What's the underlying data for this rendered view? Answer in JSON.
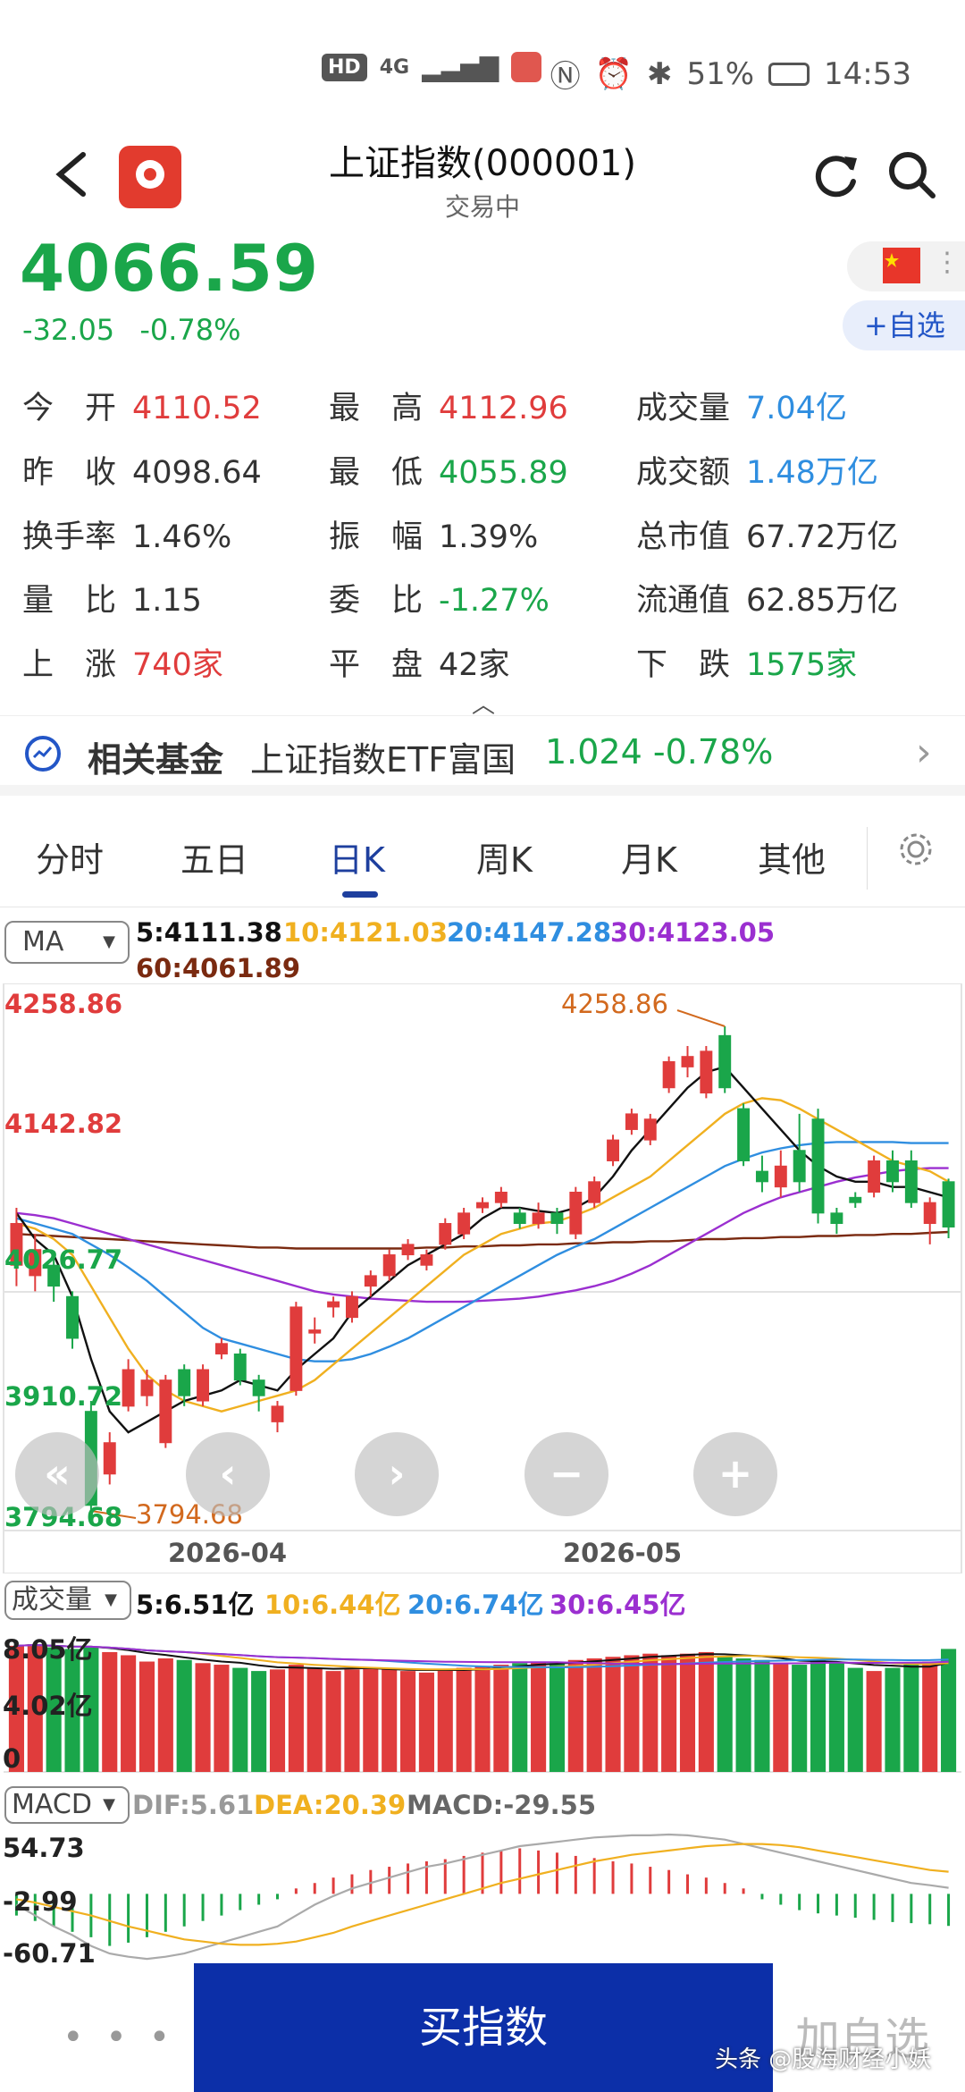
{
  "status_bar": {
    "network": "4G",
    "battery": "51%",
    "time": "14:53"
  },
  "header": {
    "title": "上证指数(000001)",
    "subtitle": "交易中"
  },
  "quote": {
    "price": "4066.59",
    "change": "-32.05",
    "change_pct": "-0.78%",
    "watch_label": "+自选"
  },
  "stats": [
    {
      "label": "今　开",
      "value": "4110.52",
      "color": "red"
    },
    {
      "label": "最　高",
      "value": "4112.96",
      "color": "red"
    },
    {
      "label": "成交量",
      "value": "7.04亿",
      "color": "blue"
    },
    {
      "label": "昨　收",
      "value": "4098.64",
      "color": "dark"
    },
    {
      "label": "最　低",
      "value": "4055.89",
      "color": "green"
    },
    {
      "label": "成交额",
      "value": "1.48万亿",
      "color": "blue"
    },
    {
      "label": "换手率",
      "value": "1.46%",
      "color": "dark"
    },
    {
      "label": "振　幅",
      "value": "1.39%",
      "color": "dark"
    },
    {
      "label": "总市值",
      "value": "67.72万亿",
      "color": "dark"
    },
    {
      "label": "量　比",
      "value": "1.15",
      "color": "dark"
    },
    {
      "label": "委　比",
      "value": "-1.27%",
      "color": "green"
    },
    {
      "label": "流通值",
      "value": "62.85万亿",
      "color": "dark"
    },
    {
      "label": "上　涨",
      "value": "740家",
      "color": "red"
    },
    {
      "label": "平　盘",
      "value": "42家",
      "color": "dark"
    },
    {
      "label": "下　跌",
      "value": "1575家",
      "color": "green"
    }
  ],
  "fund": {
    "label": "相关基金",
    "name": "上证指数ETF富国",
    "price": "1.024",
    "change_pct": "-0.78%"
  },
  "tabs": [
    "分时",
    "五日",
    "日K",
    "周K",
    "月K",
    "其他"
  ],
  "ma": {
    "selector": "MA",
    "ma5": "5:4111.38",
    "ma10": "10:4121.03",
    "ma20": "20:4147.28",
    "ma30": "30:4123.05",
    "ma60": "60:4061.89"
  },
  "kchart": {
    "y_labels": [
      "4258.86",
      "4142.82",
      "4026.77",
      "3910.72",
      "3794.68"
    ],
    "high_marker": "4258.86",
    "low_marker": "3794.68",
    "x_labels": [
      "2026-04",
      "2026-05"
    ]
  },
  "volume": {
    "selector": "成交量",
    "ma5": "5:6.51亿",
    "ma10": "10:6.44亿",
    "ma20": "20:6.74亿",
    "ma30": "30:6.45亿",
    "y_labels": [
      "8.05亿",
      "4.02亿",
      "0"
    ]
  },
  "macd": {
    "selector": "MACD",
    "dif": "DIF:5.61",
    "dea": "DEA:20.39",
    "macd": "MACD:-29.55",
    "y_labels": [
      "54.73",
      "-2.99",
      "-60.71"
    ]
  },
  "bottom": {
    "more": "• • •",
    "buy": "买指数",
    "add_watch": "加自选",
    "watermark": "头条 @股海财经小妖"
  },
  "colors": {
    "up": "#e03c3c",
    "down": "#1aa64a",
    "ma5": "#111111",
    "ma10": "#f0b020",
    "ma20": "#2f8ee0",
    "ma30": "#9b2fd0",
    "ma60": "#7a2a10",
    "accent": "#0c2fa8"
  },
  "chart_data": {
    "type": "candlestick",
    "ylim": [
      3794.68,
      4258.86
    ],
    "candles": [
      {
        "o": 4030,
        "c": 4070,
        "h": 4085,
        "l": 4010
      },
      {
        "o": 4020,
        "c": 4045,
        "h": 4060,
        "l": 4005
      },
      {
        "o": 4030,
        "c": 4010,
        "h": 4040,
        "l": 3995
      },
      {
        "o": 4000,
        "c": 3960,
        "h": 4005,
        "l": 3950
      },
      {
        "o": 3890,
        "c": 3800,
        "h": 3900,
        "l": 3794.68
      },
      {
        "o": 3830,
        "c": 3860,
        "h": 3870,
        "l": 3820
      },
      {
        "o": 3895,
        "c": 3930,
        "h": 3940,
        "l": 3890
      },
      {
        "o": 3905,
        "c": 3920,
        "h": 3930,
        "l": 3895
      },
      {
        "o": 3860,
        "c": 3920,
        "h": 3925,
        "l": 3855
      },
      {
        "o": 3930,
        "c": 3905,
        "h": 3935,
        "l": 3895
      },
      {
        "o": 3900,
        "c": 3930,
        "h": 3935,
        "l": 3895
      },
      {
        "o": 3945,
        "c": 3955,
        "h": 3960,
        "l": 3940
      },
      {
        "o": 3945,
        "c": 3920,
        "h": 3950,
        "l": 3915
      },
      {
        "o": 3920,
        "c": 3905,
        "h": 3925,
        "l": 3890
      },
      {
        "o": 3880,
        "c": 3895,
        "h": 3900,
        "l": 3870
      },
      {
        "o": 3910,
        "c": 3990,
        "h": 3995,
        "l": 3905
      },
      {
        "o": 3965,
        "c": 3968,
        "h": 3980,
        "l": 3955
      },
      {
        "o": 3990,
        "c": 3995,
        "h": 4000,
        "l": 3980
      },
      {
        "o": 3980,
        "c": 4000,
        "h": 4005,
        "l": 3975
      },
      {
        "o": 4010,
        "c": 4020,
        "h": 4025,
        "l": 4000
      },
      {
        "o": 4020,
        "c": 4040,
        "h": 4045,
        "l": 4015
      },
      {
        "o": 4040,
        "c": 4050,
        "h": 4055,
        "l": 4035
      },
      {
        "o": 4030,
        "c": 4040,
        "h": 4045,
        "l": 4025
      },
      {
        "o": 4050,
        "c": 4070,
        "h": 4075,
        "l": 4045
      },
      {
        "o": 4060,
        "c": 4080,
        "h": 4085,
        "l": 4055
      },
      {
        "o": 4085,
        "c": 4090,
        "h": 4095,
        "l": 4080
      },
      {
        "o": 4090,
        "c": 4100,
        "h": 4105,
        "l": 4085
      },
      {
        "o": 4080,
        "c": 4070,
        "h": 4085,
        "l": 4065
      },
      {
        "o": 4070,
        "c": 4080,
        "h": 4090,
        "l": 4065
      },
      {
        "o": 4080,
        "c": 4070,
        "h": 4085,
        "l": 4060
      },
      {
        "o": 4060,
        "c": 4100,
        "h": 4105,
        "l": 4055
      },
      {
        "o": 4090,
        "c": 4110,
        "h": 4115,
        "l": 4085
      },
      {
        "o": 4130,
        "c": 4150,
        "h": 4155,
        "l": 4125
      },
      {
        "o": 4160,
        "c": 4175,
        "h": 4180,
        "l": 4155
      },
      {
        "o": 4150,
        "c": 4170,
        "h": 4175,
        "l": 4145
      },
      {
        "o": 4200,
        "c": 4225,
        "h": 4230,
        "l": 4195
      },
      {
        "o": 4220,
        "c": 4230,
        "h": 4240,
        "l": 4210
      },
      {
        "o": 4195,
        "c": 4235,
        "h": 4240,
        "l": 4190
      },
      {
        "o": 4250,
        "c": 4200,
        "h": 4258.86,
        "l": 4195
      },
      {
        "o": 4180,
        "c": 4130,
        "h": 4185,
        "l": 4125
      },
      {
        "o": 4120,
        "c": 4110,
        "h": 4135,
        "l": 4100
      },
      {
        "o": 4105,
        "c": 4125,
        "h": 4140,
        "l": 4095
      },
      {
        "o": 4140,
        "c": 4110,
        "h": 4175,
        "l": 4100
      },
      {
        "o": 4170,
        "c": 4080,
        "h": 4180,
        "l": 4070
      },
      {
        "o": 4080,
        "c": 4070,
        "h": 4085,
        "l": 4060
      },
      {
        "o": 4095,
        "c": 4090,
        "h": 4100,
        "l": 4085
      },
      {
        "o": 4100,
        "c": 4130,
        "h": 4135,
        "l": 4095
      },
      {
        "o": 4130,
        "c": 4110,
        "h": 4140,
        "l": 4100
      },
      {
        "o": 4130,
        "c": 4090,
        "h": 4140,
        "l": 4085
      },
      {
        "o": 4070,
        "c": 4090,
        "h": 4095,
        "l": 4050
      },
      {
        "o": 4110,
        "c": 4066.59,
        "h": 4112.96,
        "l": 4055.89
      }
    ],
    "ma5": [
      4080,
      4055,
      4040,
      4000,
      3940,
      3890,
      3870,
      3880,
      3890,
      3900,
      3905,
      3910,
      3920,
      3915,
      3910,
      3930,
      3945,
      3960,
      3985,
      4000,
      4015,
      4030,
      4040,
      4050,
      4060,
      4075,
      4085,
      4085,
      4082,
      4080,
      4085,
      4095,
      4115,
      4140,
      4160,
      4180,
      4200,
      4215,
      4220,
      4200,
      4180,
      4160,
      4140,
      4125,
      4115,
      4110,
      4110,
      4105,
      4105,
      4100,
      4095
    ],
    "ma10": [
      4070,
      4065,
      4055,
      4040,
      4010,
      3980,
      3950,
      3925,
      3910,
      3900,
      3895,
      3890,
      3895,
      3900,
      3905,
      3910,
      3920,
      3935,
      3950,
      3965,
      3980,
      3995,
      4010,
      4025,
      4040,
      4050,
      4060,
      4065,
      4070,
      4072,
      4078,
      4085,
      4095,
      4105,
      4115,
      4130,
      4145,
      4160,
      4175,
      4185,
      4190,
      4188,
      4180,
      4170,
      4160,
      4150,
      4140,
      4130,
      4125,
      4120,
      4110
    ],
    "ma20": [
      4075,
      4070,
      4065,
      4060,
      4050,
      4040,
      4028,
      4015,
      4000,
      3985,
      3970,
      3960,
      3955,
      3950,
      3945,
      3940,
      3938,
      3938,
      3940,
      3945,
      3952,
      3960,
      3970,
      3980,
      3990,
      4000,
      4010,
      4020,
      4030,
      4040,
      4048,
      4055,
      4065,
      4075,
      4085,
      4095,
      4105,
      4115,
      4125,
      4132,
      4138,
      4142,
      4145,
      4147,
      4148,
      4148,
      4148,
      4148,
      4147,
      4147,
      4147
    ],
    "ma30": [
      4080,
      4078,
      4075,
      4070,
      4065,
      4060,
      4055,
      4050,
      4045,
      4040,
      4035,
      4030,
      4025,
      4020,
      4015,
      4010,
      4005,
      4002,
      4000,
      3998,
      3997,
      3996,
      3995,
      3995,
      3995,
      3996,
      3997,
      3998,
      4000,
      4003,
      4006,
      4010,
      4015,
      4022,
      4030,
      4040,
      4050,
      4060,
      4070,
      4080,
      4088,
      4095,
      4100,
      4105,
      4110,
      4114,
      4117,
      4120,
      4122,
      4123,
      4123
    ],
    "ma60": [
      4060,
      4059,
      4058,
      4057,
      4056,
      4055,
      4054,
      4053,
      4052,
      4051,
      4050,
      4049,
      4048,
      4047,
      4047,
      4046,
      4046,
      4046,
      4046,
      4046,
      4046,
      4046,
      4047,
      4047,
      4048,
      4048,
      4049,
      4049,
      4050,
      4050,
      4051,
      4051,
      4052,
      4052,
      4053,
      4053,
      4054,
      4055,
      4055,
      4056,
      4056,
      4057,
      4057,
      4058,
      4058,
      4059,
      4059,
      4060,
      4060,
      4061,
      4061.89
    ],
    "volume_ylim": [
      0,
      8.05
    ],
    "volume": [
      8.0,
      8.1,
      7.9,
      7.8,
      7.9,
      7.6,
      7.4,
      7.0,
      7.2,
      7.1,
      6.9,
      6.8,
      6.6,
      6.4,
      6.5,
      6.8,
      6.6,
      6.4,
      6.5,
      6.6,
      6.5,
      6.4,
      6.3,
      6.5,
      6.6,
      6.7,
      6.8,
      6.9,
      7.0,
      6.9,
      7.1,
      7.2,
      7.3,
      7.4,
      7.5,
      7.4,
      7.5,
      7.6,
      7.3,
      7.2,
      7.1,
      6.9,
      6.8,
      7.1,
      7.0,
      6.6,
      6.4,
      6.6,
      6.8,
      7.0,
      7.8
    ],
    "macd_ylim": [
      -60.71,
      54.73
    ],
    "macd_hist": [
      -20,
      -25,
      -30,
      -35,
      -40,
      -48,
      -45,
      -40,
      -35,
      -30,
      -25,
      -20,
      -15,
      -10,
      -5,
      5,
      10,
      15,
      18,
      22,
      25,
      28,
      30,
      32,
      35,
      38,
      40,
      42,
      40,
      38,
      35,
      33,
      30,
      28,
      25,
      22,
      18,
      15,
      10,
      5,
      -5,
      -10,
      -15,
      -18,
      -20,
      -22,
      -24,
      -26,
      -27,
      -28,
      -29.55
    ],
    "dif": [
      -10,
      -20,
      -30,
      -38,
      -48,
      -55,
      -58,
      -60,
      -58,
      -55,
      -50,
      -45,
      -40,
      -35,
      -30,
      -20,
      -10,
      -2,
      5,
      10,
      15,
      20,
      25,
      28,
      32,
      36,
      40,
      44,
      46,
      48,
      50,
      52,
      53,
      54,
      54,
      54.73,
      54,
      52,
      50,
      46,
      42,
      38,
      34,
      30,
      26,
      22,
      18,
      14,
      10,
      8,
      5.61
    ],
    "dea": [
      -5,
      -8,
      -12,
      -16,
      -20,
      -25,
      -30,
      -34,
      -38,
      -42,
      -44,
      -46,
      -47,
      -47,
      -46,
      -44,
      -40,
      -36,
      -30,
      -25,
      -20,
      -15,
      -10,
      -5,
      0,
      5,
      10,
      14,
      18,
      22,
      26,
      30,
      33,
      36,
      38,
      40,
      42,
      44,
      45,
      46,
      46,
      45,
      43,
      40,
      37,
      34,
      31,
      28,
      25,
      22,
      20.39
    ]
  }
}
